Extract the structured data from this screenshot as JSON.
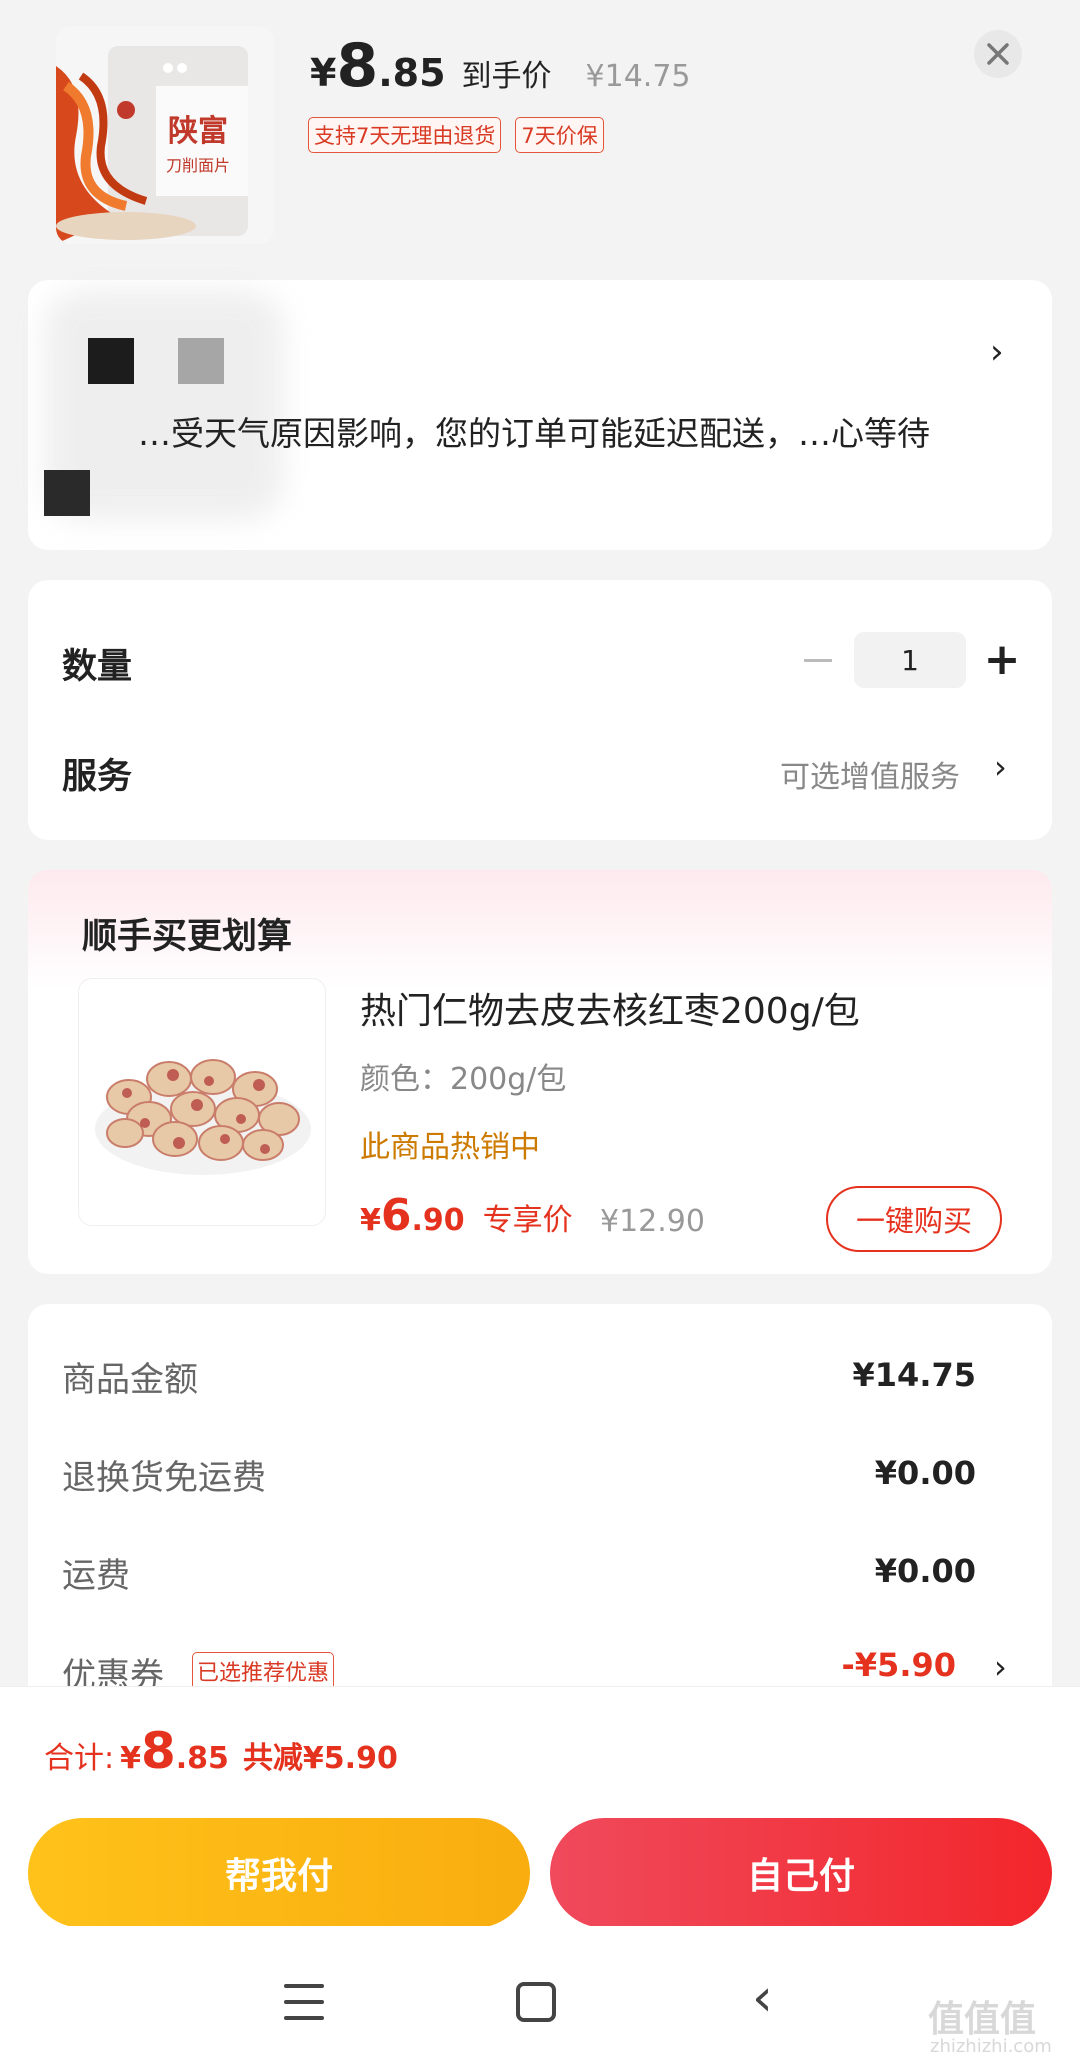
{
  "product": {
    "price_yen": "¥",
    "price_int": "8",
    "price_dec": ".85",
    "price_tag": "到手价",
    "original_price": "¥14.75",
    "badges": [
      "支持7天无理由退货",
      "7天价保"
    ],
    "image_brand_text": "陕富",
    "image_sub_text": "刀削面片"
  },
  "address": {
    "notice": "…受天气原因影响，您的订单可能延迟配送，…心等待"
  },
  "quantity": {
    "label": "数量",
    "value": "1",
    "minus": "−",
    "plus": "+"
  },
  "service": {
    "label": "服务",
    "value": "可选增值服务"
  },
  "recommend": {
    "title": "顺手买更划算",
    "name": "热门仁物去皮去核红枣200g/包",
    "spec": "颜色：200g/包",
    "hot": "此商品热销中",
    "price_yen": "¥",
    "price_int": "6",
    "price_dec": ".90",
    "price_tag": "专享价",
    "original_price": "¥12.90",
    "buy_button": "一键购买"
  },
  "summary": {
    "rows": [
      {
        "label": "商品金额",
        "value": "¥14.75"
      },
      {
        "label": "退换货免运费",
        "value": "¥0.00"
      },
      {
        "label": "运费",
        "value": "¥0.00"
      },
      {
        "label": "优惠券",
        "value": "-¥5.90"
      }
    ],
    "coupon_badge": "已选推荐优惠"
  },
  "total": {
    "label": "合计:",
    "yen": "¥",
    "int": "8",
    "dec": ".85",
    "saved": "共减¥5.90"
  },
  "actions": {
    "help_pay": "帮我付",
    "self_pay": "自己付"
  },
  "watermark": {
    "main": "值值值",
    "sub": "zhizhizhi.com"
  },
  "colors": {
    "accent_red": "#e5321e",
    "help_btn": "#f9ad0f",
    "self_btn": "#f2262b"
  }
}
